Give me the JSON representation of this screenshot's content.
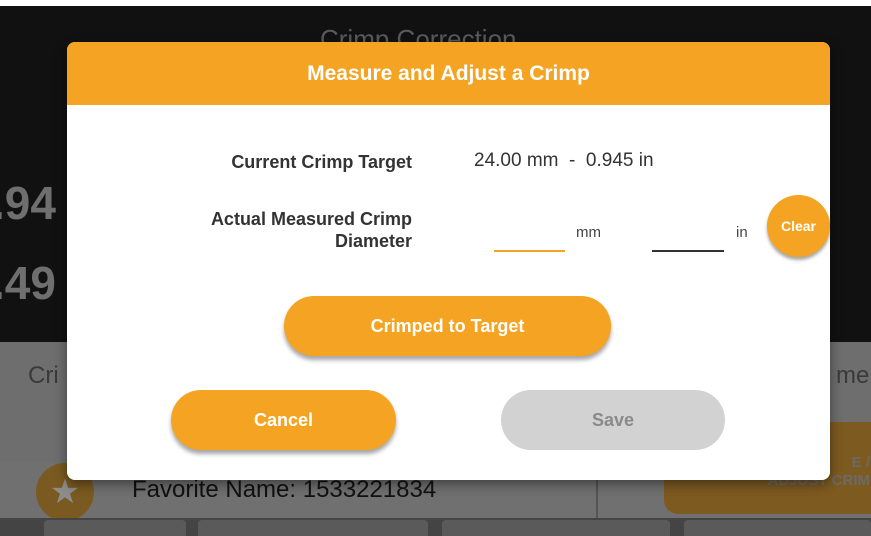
{
  "background": {
    "screen_title": "Crimp Correction",
    "big_value_1": ".94",
    "big_value_2": ".49",
    "crim_left": "Cri",
    "crim_right": "mer",
    "favorite_name": "Favorite Name: 1533221834",
    "measure_button": "E /\nADJUST CRIM",
    "star_icon": "star-icon"
  },
  "dialog": {
    "title": "Measure and Adjust a Crimp",
    "current_target_label": "Current Crimp Target",
    "current_target_value": "24.00 mm  -  0.945 in",
    "actual_label_line1": "Actual Measured Crimp",
    "actual_label_line2": "Diameter",
    "mm_value": "",
    "mm_unit": "mm",
    "in_value": "",
    "in_unit": "in",
    "clear_label": "Clear",
    "crimped_to_target_label": "Crimped to Target",
    "cancel_label": "Cancel",
    "save_label": "Save"
  },
  "colors": {
    "accent": "#f4a422",
    "disabled": "#d2d2d2"
  }
}
